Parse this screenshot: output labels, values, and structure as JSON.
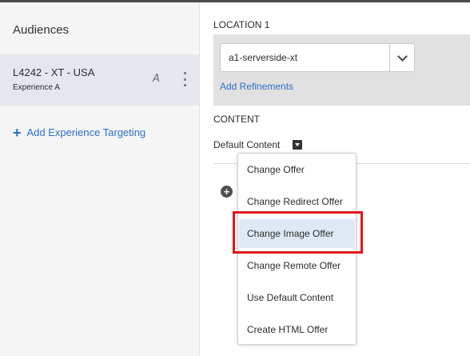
{
  "left_panel": {
    "title": "Audiences",
    "audience": {
      "name": "L4242 - XT - USA",
      "experience": "Experience A",
      "icon_a": "A",
      "edit_icon": "font-edit-icon",
      "more_icon": "more-vertical-icon"
    },
    "add_targeting_label": "Add Experience Targeting",
    "add_icon": "plus-icon"
  },
  "location": {
    "label": "LOCATION 1",
    "selected": "a1-serverside-xt",
    "add_refinements": "Add Refinements"
  },
  "content": {
    "label": "CONTENT",
    "default_content": "Default Content"
  },
  "menu": {
    "items": [
      "Change Offer",
      "Change Redirect Offer",
      "Change Image Offer",
      "Change Remote Offer",
      "Use Default Content",
      "Create HTML Offer"
    ],
    "highlighted_index": 2
  },
  "colors": {
    "accent": "#2d6ec7",
    "highlight_border": "#e0161d",
    "selected_item_bg": "#e4e8ee"
  }
}
